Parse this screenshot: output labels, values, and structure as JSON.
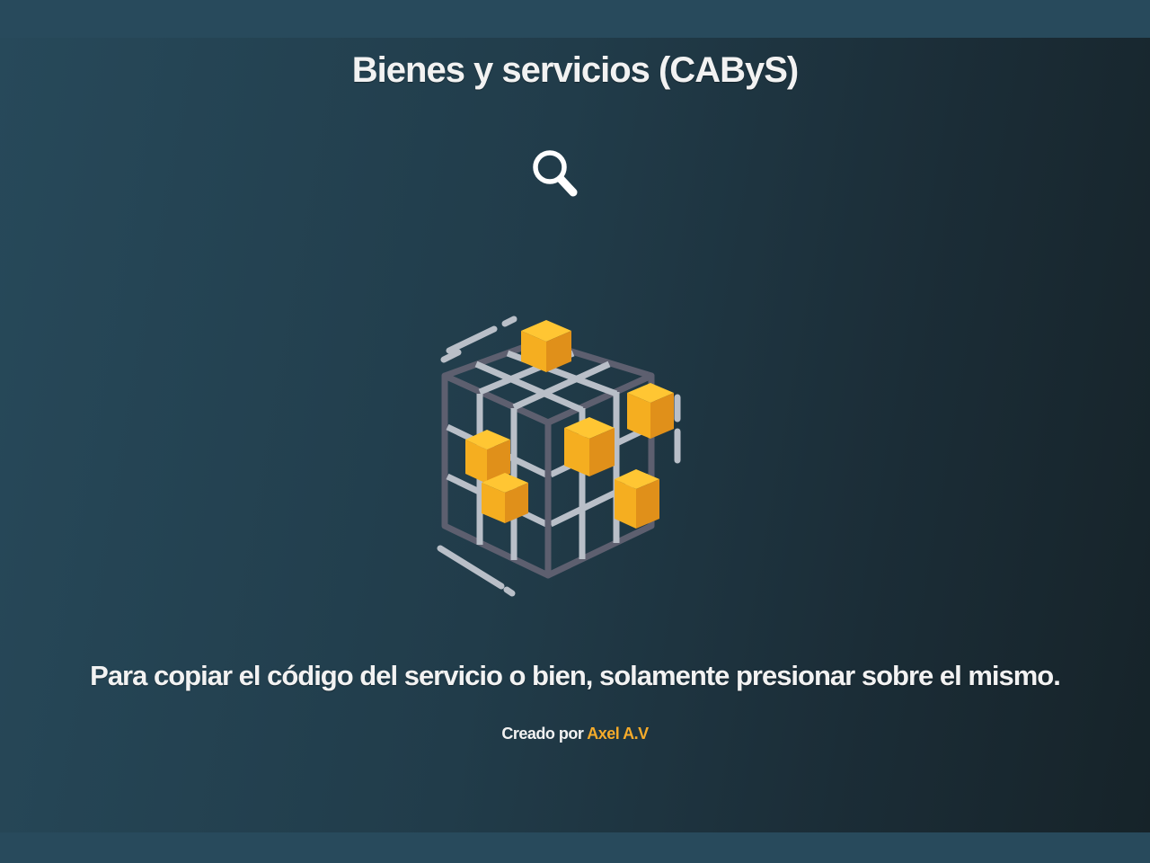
{
  "page": {
    "title": "Bienes y servicios (CAByS)",
    "instructions": "Para copiar el código del servicio o bien, solamente presionar sobre el mismo.",
    "credit_prefix": "Creado por",
    "credit_author": "Axel A.V"
  },
  "icons": {
    "search": "search-icon",
    "illustration": "cube-grid-illustration"
  },
  "colors": {
    "background_start": "#27495a",
    "background_end": "#162329",
    "text": "#f2f2f2",
    "accent": "#f5ab2a",
    "cube_frame": "#5d5f6f",
    "cube_bars": "#b9bfc8",
    "block_light": "#ffc633",
    "block_mid": "#f5ae20",
    "block_dark": "#e0901a"
  }
}
